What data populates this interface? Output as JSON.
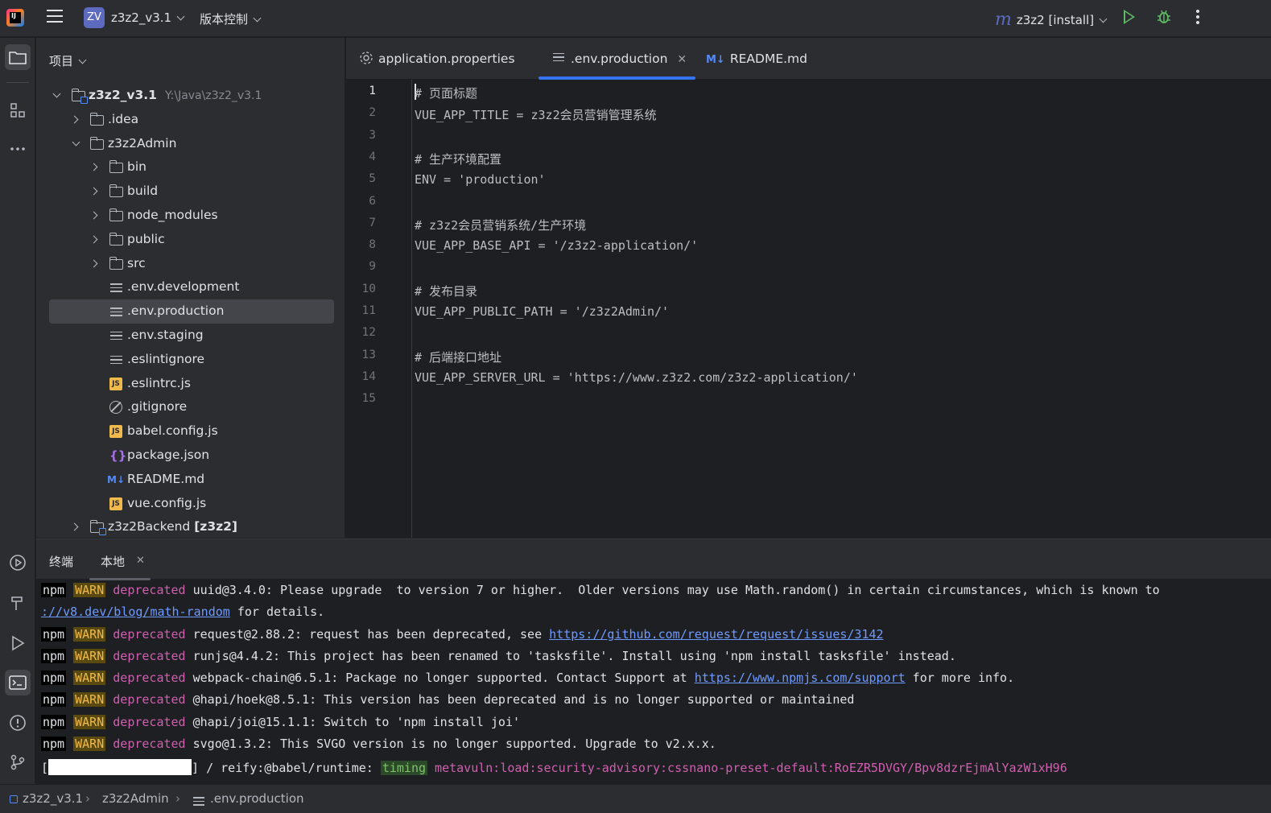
{
  "topbar": {
    "project_badge": "ZV",
    "project_name": "z3z2_v3.1",
    "vcs_label": "版本控制",
    "run_config_label": "z3z2 [install]"
  },
  "project_panel": {
    "header": "项目",
    "tree": [
      {
        "label": "z3z2_v3.1",
        "path": "Y:\\Java\\z3z2_v3.1",
        "type": "module-folder",
        "expanded": true
      },
      {
        "label": ".idea",
        "type": "folder",
        "expanded": false
      },
      {
        "label": "z3z2Admin",
        "type": "folder",
        "expanded": true
      },
      {
        "label": "bin",
        "type": "folder",
        "expanded": false
      },
      {
        "label": "build",
        "type": "folder",
        "expanded": false
      },
      {
        "label": "node_modules",
        "type": "folder",
        "expanded": false
      },
      {
        "label": "public",
        "type": "folder",
        "expanded": false
      },
      {
        "label": "src",
        "type": "folder",
        "expanded": false
      },
      {
        "label": ".env.development",
        "type": "text-file"
      },
      {
        "label": ".env.production",
        "type": "text-file",
        "selected": true
      },
      {
        "label": ".env.staging",
        "type": "text-file"
      },
      {
        "label": ".eslintignore",
        "type": "text-file"
      },
      {
        "label": ".eslintrc.js",
        "type": "js-file"
      },
      {
        "label": ".gitignore",
        "type": "ignore-file"
      },
      {
        "label": "babel.config.js",
        "type": "js-file"
      },
      {
        "label": "package.json",
        "type": "json-file"
      },
      {
        "label": "README.md",
        "type": "markdown-file"
      },
      {
        "label": "vue.config.js",
        "type": "js-file"
      },
      {
        "label": "z3z2Backend",
        "suffix": "[z3z2]",
        "type": "module-folder",
        "expanded": false
      }
    ]
  },
  "editor": {
    "tabs": [
      {
        "label": "application.properties",
        "icon": "gear-icon"
      },
      {
        "label": ".env.production",
        "icon": "text-file-icon",
        "active": true,
        "close": "✕"
      },
      {
        "label": "README.md",
        "icon": "markdown-icon"
      }
    ],
    "lines": [
      {
        "n": "1",
        "text": "# 页面标题"
      },
      {
        "n": "2",
        "text": "VUE_APP_TITLE = z3z2会员营销管理系统"
      },
      {
        "n": "3",
        "text": ""
      },
      {
        "n": "4",
        "text": "# 生产环境配置"
      },
      {
        "n": "5",
        "text": "ENV = 'production'"
      },
      {
        "n": "6",
        "text": ""
      },
      {
        "n": "7",
        "text": "# z3z2会员营销系统/生产环境"
      },
      {
        "n": "8",
        "text": "VUE_APP_BASE_API = '/z3z2-application/'"
      },
      {
        "n": "9",
        "text": ""
      },
      {
        "n": "10",
        "text": "# 发布目录"
      },
      {
        "n": "11",
        "text": "VUE_APP_PUBLIC_PATH = '/z3z2Admin/'"
      },
      {
        "n": "12",
        "text": ""
      },
      {
        "n": "13",
        "text": "# 后端接口地址"
      },
      {
        "n": "14",
        "text": "VUE_APP_SERVER_URL = 'https://www.z3z2.com/z3z2-application/'"
      },
      {
        "n": "15",
        "text": ""
      }
    ]
  },
  "terminal": {
    "tab_title": "终端",
    "session_tab": "本地",
    "session_close": "✕",
    "npm": "npm",
    "warn": "WARN",
    "deprecated": "deprecated",
    "lines": {
      "l1": " uuid@3.4.0: Please upgrade  to version 7 or higher.  Older versions may use Math.random() in certain circumstances, which is known to",
      "l2_link": "://v8.dev/blog/math-random",
      "l2_rest": " for details.",
      "l3_pre": " request@2.88.2: request has been deprecated, see ",
      "l3_link": "https://github.com/request/request/issues/3142",
      "l4": " runjs@4.4.2: This project has been renamed to 'tasksfile'. Install using 'npm install tasksfile' instead.",
      "l5_pre": " webpack-chain@6.5.1: Package no longer supported. Contact Support at ",
      "l5_link": "https://www.npmjs.com/support",
      "l5_post": " for more info.",
      "l6": " @hapi/hoek@8.5.1: This version has been deprecated and is no longer supported or maintained",
      "l7": " @hapi/joi@15.1.1: Switch to 'npm install joi'",
      "l8": " svgo@1.3.2: This SVGO version is no longer supported. Upgrade to v2.x.x.",
      "l9_open": "[",
      "l9_mid": "] / reify:@babel/runtime: ",
      "l9_timing": "timing",
      "l9_meta": " metavuln:load:security-advisory:cssnano-preset-default:RoEZR5DVGY/Bpv8dzrEjmAlYazW1xH96"
    }
  },
  "statusbar": {
    "crumbs": [
      "z3z2_v3.1",
      "z3z2Admin",
      ".env.production"
    ],
    "sep": "›"
  }
}
